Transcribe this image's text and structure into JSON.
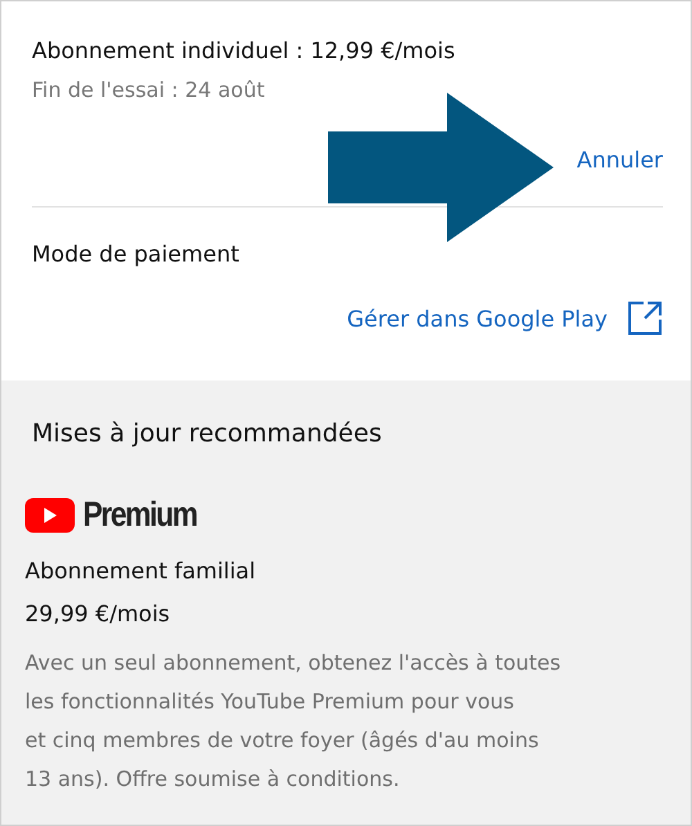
{
  "subscription": {
    "title": "Abonnement individuel : 12,99 €/mois",
    "trial_end": "Fin de l'essai : 24 août",
    "cancel_link": "Annuler"
  },
  "payment": {
    "label": "Mode de paiement",
    "manage_link": "Gérer dans Google Play"
  },
  "recommended": {
    "heading": "Mises à jour recommandées",
    "logo_text": "Premium",
    "plan": "Abonnement familial",
    "price": "29,99 €/mois",
    "description": "Avec un seul abonnement, obtenez l'accès à toutes\nles fonctionnalités YouTube Premium pour vous\net cinq membres de votre foyer (âgés d'au moins\n13 ans). Offre soumise à conditions."
  }
}
